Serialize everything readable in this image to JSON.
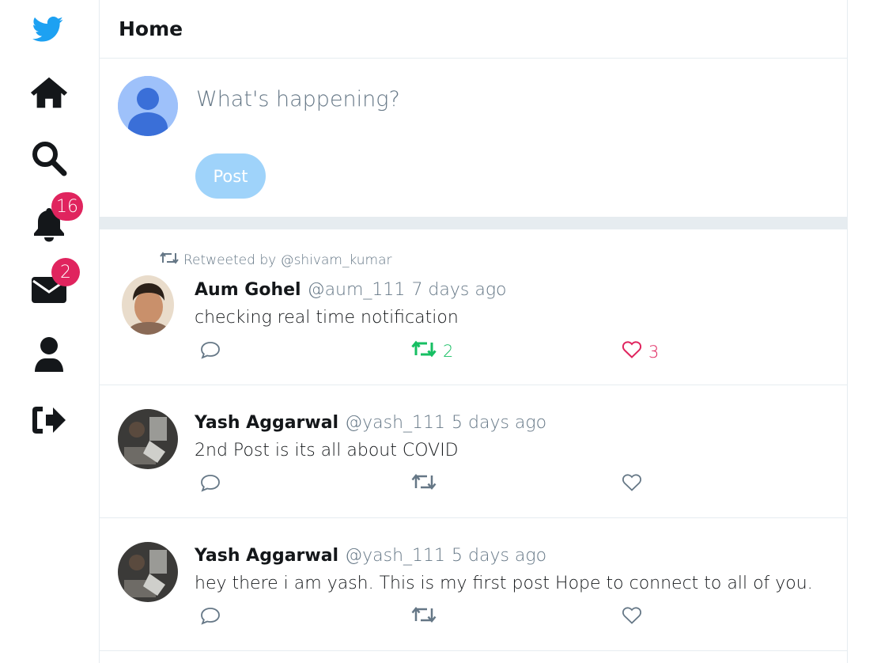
{
  "sidebar": {
    "items": [
      {
        "name": "logo",
        "icon": "bird-logo-icon"
      },
      {
        "name": "home",
        "icon": "home-icon"
      },
      {
        "name": "search",
        "icon": "search-icon"
      },
      {
        "name": "notifications",
        "icon": "bell-icon",
        "badge": "16"
      },
      {
        "name": "messages",
        "icon": "envelope-icon",
        "badge": "2"
      },
      {
        "name": "profile",
        "icon": "user-icon"
      },
      {
        "name": "logout",
        "icon": "sign-out-icon"
      }
    ]
  },
  "header": {
    "title": "Home"
  },
  "compose": {
    "placeholder": "What's happening?",
    "post_label": "Post"
  },
  "posts": [
    {
      "retweeted_by": "Retweeted by @shivam_kumar",
      "author": "Aum Gohel",
      "handle": "@aum_111",
      "time": "7 days ago",
      "content": "checking real time notification",
      "retweets": "2",
      "likes": "3"
    },
    {
      "author": "Yash Aggarwal",
      "handle": "@yash_111",
      "time": "5 days ago",
      "content": "2nd Post is its all about COVID",
      "retweets": "",
      "likes": ""
    },
    {
      "author": "Yash Aggarwal",
      "handle": "@yash_111",
      "time": "5 days ago",
      "content": "hey there i am yash. This is my first post Hope to connect to all of you.",
      "retweets": "",
      "likes": ""
    }
  ],
  "colors": {
    "brand": "#1da1f2",
    "retweet_active": "#17bf63",
    "like_active": "#e0245e",
    "badge": "#e0245e",
    "muted": "#657786"
  }
}
